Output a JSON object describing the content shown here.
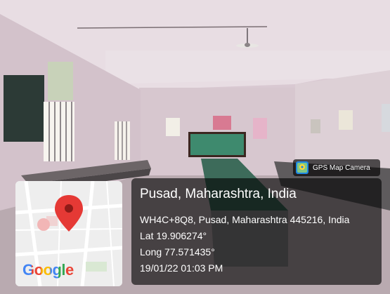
{
  "badge": {
    "app_name": "GPS Map Camera",
    "icon": "gps-map-camera-icon"
  },
  "map": {
    "logo_text": "Google",
    "marker_icon": "map-pin-icon"
  },
  "location": {
    "title": "Pusad, Maharashtra, India",
    "address": "WH4C+8Q8, Pusad, Maharashtra 445216, India",
    "latitude": "Lat 19.906274°",
    "longitude": "Long 77.571435°",
    "datetime": "19/01/22 01:03 PM"
  },
  "colors": {
    "pin_red": "#e53935",
    "overlay": "#000000"
  }
}
